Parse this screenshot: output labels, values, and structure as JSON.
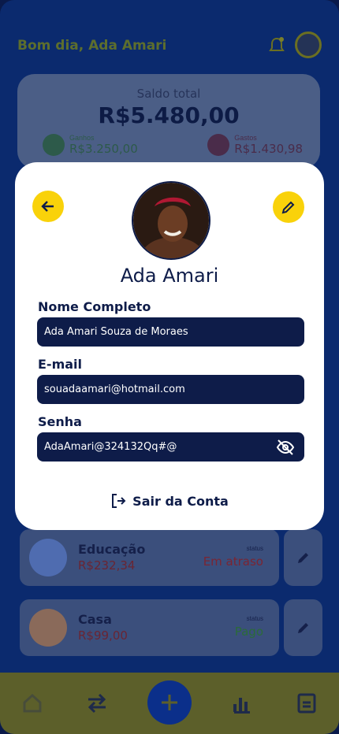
{
  "header": {
    "greeting": "Bom dia, Ada Amari"
  },
  "balance": {
    "label": "Saldo total",
    "value": "R$5.480,00",
    "income_label": "Ganhos",
    "income_value": "R$3.250,00",
    "expense_label": "Gastos",
    "expense_value": "R$1.430,98"
  },
  "categories": [
    {
      "name": "Educação",
      "amount": "R$232,34",
      "status_label": "status",
      "status_value": "Em atraso",
      "status_color": "#8a2a3a",
      "icon": "graduation-cap-icon"
    },
    {
      "name": "Casa",
      "amount": "R$99,00",
      "status_label": "status",
      "status_value": "Pago",
      "status_color": "#2b6b3a",
      "icon": "house-icon"
    }
  ],
  "profile": {
    "name": "Ada Amari",
    "full_name_label": "Nome Completo",
    "full_name_value": "Ada Amari Souza de Moraes",
    "email_label": "E-mail",
    "email_value": "souadaamari@hotmail.com",
    "password_label": "Senha",
    "password_value": "AdaAmari@324132Qq#@",
    "logout_label": "Sair da Conta"
  },
  "nav": [
    "home-icon",
    "transfer-icon",
    "add-icon",
    "chart-icon",
    "document-icon"
  ],
  "colors": {
    "navy": "#0e1c49",
    "yellow": "#f9d20a",
    "blue": "#0b2a6e"
  }
}
